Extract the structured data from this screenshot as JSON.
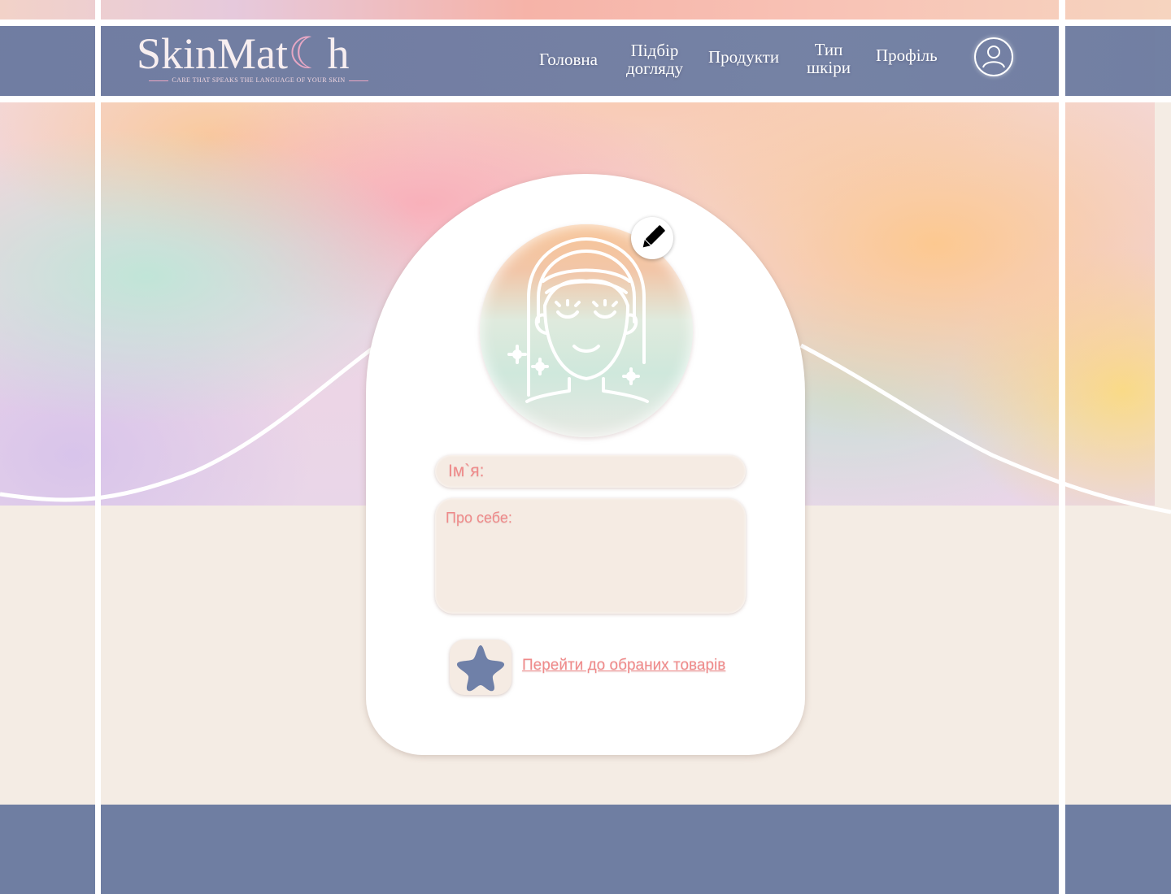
{
  "brand": {
    "name_start": "SkinMat",
    "name_end": "h",
    "tagline": "CARE THAT SPEAKS THE LANGUAGE OF YOUR SKIN"
  },
  "nav": {
    "home": "Головна",
    "care_line1": "Підбір",
    "care_line2": "догляду",
    "products": "Продукти",
    "skin_line1": "Тип",
    "skin_line2": "шкіри",
    "profile": "Профіль"
  },
  "icons": {
    "account": "user-circle-icon",
    "edit": "pencil-icon",
    "avatar": "face-sparkles-icon",
    "favorites": "star-icon"
  },
  "profile": {
    "name_placeholder": "Ім`я:",
    "about_placeholder": "Про себе:",
    "favorites_link": "Перейти до обраних товарів"
  },
  "colors": {
    "navbar": "#6f7ca2",
    "accent_text": "#ef8a8a",
    "star": "#6f80a8",
    "page_bg": "#f4ece4"
  }
}
